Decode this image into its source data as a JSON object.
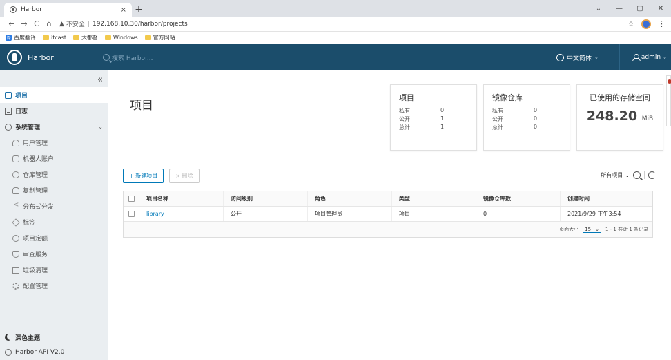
{
  "browser": {
    "tab_title": "Harbor",
    "tab_close": "×",
    "new_tab": "+",
    "win_min": "—",
    "win_max": "▢",
    "win_close": "✕",
    "win_chevron": "⌄",
    "nav_back": "←",
    "nav_forward": "→",
    "nav_reload": "C",
    "nav_home": "⌂",
    "insecure": "不安全",
    "url": "192.168.10.30/harbor/projects",
    "bookmarks": [
      "百度翻译",
      "itcast",
      "大都督",
      "Windows",
      "官方网站"
    ]
  },
  "header": {
    "brand": "Harbor",
    "search_placeholder": "搜索 Harbor...",
    "language": "中文简体",
    "user": "admin"
  },
  "sidebar": {
    "collapse": "«",
    "projects": "项目",
    "logs": "日志",
    "admin": "系统管理",
    "sub": [
      "用户管理",
      "机器人账户",
      "仓库管理",
      "复制管理",
      "分布式分发",
      "标签",
      "项目定额",
      "审查服务",
      "垃圾清理",
      "配置管理"
    ],
    "dark_theme": "深色主题",
    "api": "Harbor API V2.0"
  },
  "page": {
    "title": "项目"
  },
  "cards": {
    "projects": {
      "title": "项目",
      "rows": [
        {
          "k": "私有",
          "v": "0"
        },
        {
          "k": "公开",
          "v": "1"
        },
        {
          "k": "总计",
          "v": "1"
        }
      ]
    },
    "repos": {
      "title": "镜像仓库",
      "rows": [
        {
          "k": "私有",
          "v": "0"
        },
        {
          "k": "公开",
          "v": "0"
        },
        {
          "k": "总计",
          "v": "0"
        }
      ]
    },
    "storage": {
      "title": "已使用的存储空间",
      "value": "248.20",
      "unit": "MiB"
    }
  },
  "toolbar": {
    "new_project": "+ 新建项目",
    "delete": "× 删除",
    "filter": "所有项目"
  },
  "table": {
    "headers": [
      "项目名称",
      "访问级别",
      "角色",
      "类型",
      "镜像仓库数",
      "创建时间"
    ],
    "rows": [
      [
        "library",
        "公开",
        "项目管理员",
        "项目",
        "0",
        "2021/9/29 下午3:54"
      ]
    ],
    "page_size_label": "页面大小",
    "page_size": "15",
    "summary": "1 - 1 共计 1 条记录"
  },
  "colors": {
    "header_bg": "#1b4d6b",
    "sidebar_bg": "#eaeef1",
    "accent": "#0079b8"
  }
}
